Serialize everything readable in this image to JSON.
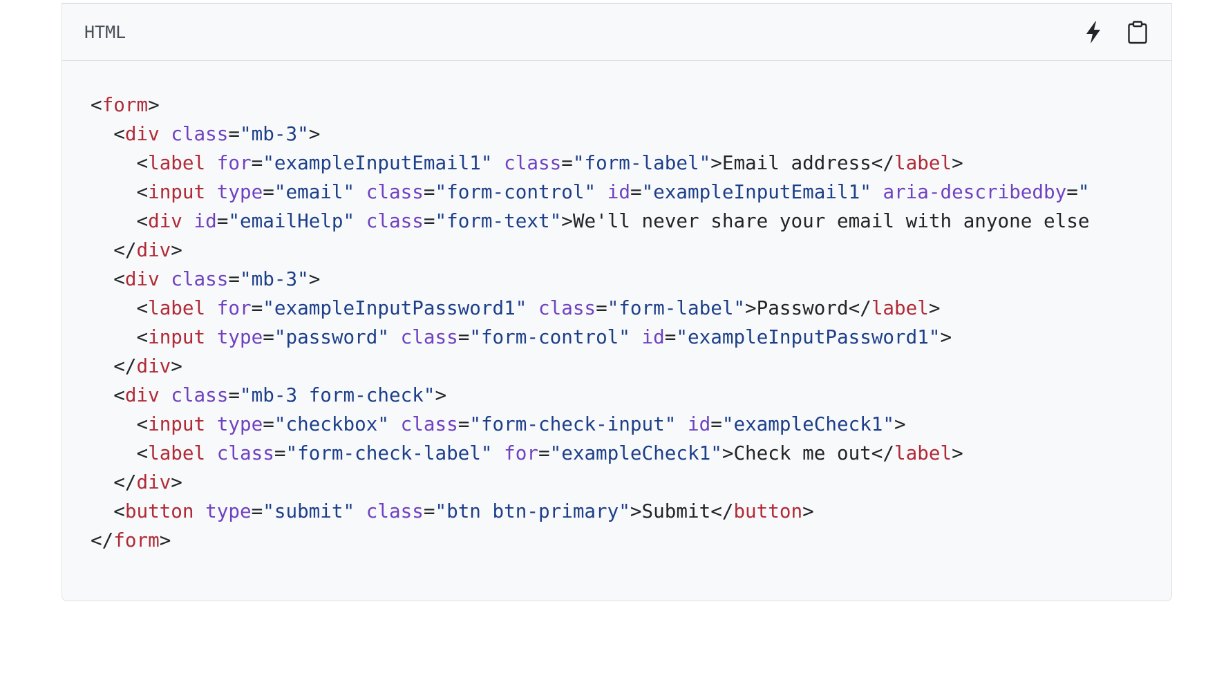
{
  "code_block": {
    "language_label": "HTML",
    "actions": [
      {
        "name": "lightning-icon"
      },
      {
        "name": "clipboard-icon"
      }
    ],
    "lines": [
      [
        {
          "t": "punc",
          "v": "<"
        },
        {
          "t": "tag",
          "v": "form"
        },
        {
          "t": "punc",
          "v": ">"
        }
      ],
      [
        {
          "t": "punc",
          "v": "  <"
        },
        {
          "t": "tag",
          "v": "div"
        },
        {
          "t": "punc",
          "v": " "
        },
        {
          "t": "attr",
          "v": "class"
        },
        {
          "t": "punc",
          "v": "="
        },
        {
          "t": "str",
          "v": "\"mb-3\""
        },
        {
          "t": "punc",
          "v": ">"
        }
      ],
      [
        {
          "t": "punc",
          "v": "    <"
        },
        {
          "t": "tag",
          "v": "label"
        },
        {
          "t": "punc",
          "v": " "
        },
        {
          "t": "attr",
          "v": "for"
        },
        {
          "t": "punc",
          "v": "="
        },
        {
          "t": "str",
          "v": "\"exampleInputEmail1\""
        },
        {
          "t": "punc",
          "v": " "
        },
        {
          "t": "attr",
          "v": "class"
        },
        {
          "t": "punc",
          "v": "="
        },
        {
          "t": "str",
          "v": "\"form-label\""
        },
        {
          "t": "punc",
          "v": ">"
        },
        {
          "t": "text",
          "v": "Email address"
        },
        {
          "t": "punc",
          "v": "</"
        },
        {
          "t": "tag",
          "v": "label"
        },
        {
          "t": "punc",
          "v": ">"
        }
      ],
      [
        {
          "t": "punc",
          "v": "    <"
        },
        {
          "t": "tag",
          "v": "input"
        },
        {
          "t": "punc",
          "v": " "
        },
        {
          "t": "attr",
          "v": "type"
        },
        {
          "t": "punc",
          "v": "="
        },
        {
          "t": "str",
          "v": "\"email\""
        },
        {
          "t": "punc",
          "v": " "
        },
        {
          "t": "attr",
          "v": "class"
        },
        {
          "t": "punc",
          "v": "="
        },
        {
          "t": "str",
          "v": "\"form-control\""
        },
        {
          "t": "punc",
          "v": " "
        },
        {
          "t": "attr",
          "v": "id"
        },
        {
          "t": "punc",
          "v": "="
        },
        {
          "t": "str",
          "v": "\"exampleInputEmail1\""
        },
        {
          "t": "punc",
          "v": " "
        },
        {
          "t": "attr",
          "v": "aria-describedby"
        },
        {
          "t": "punc",
          "v": "="
        },
        {
          "t": "str",
          "v": "\""
        }
      ],
      [
        {
          "t": "punc",
          "v": "    <"
        },
        {
          "t": "tag",
          "v": "div"
        },
        {
          "t": "punc",
          "v": " "
        },
        {
          "t": "attr",
          "v": "id"
        },
        {
          "t": "punc",
          "v": "="
        },
        {
          "t": "str",
          "v": "\"emailHelp\""
        },
        {
          "t": "punc",
          "v": " "
        },
        {
          "t": "attr",
          "v": "class"
        },
        {
          "t": "punc",
          "v": "="
        },
        {
          "t": "str",
          "v": "\"form-text\""
        },
        {
          "t": "punc",
          "v": ">"
        },
        {
          "t": "text",
          "v": "We'll never share your email with anyone else"
        }
      ],
      [
        {
          "t": "punc",
          "v": "  </"
        },
        {
          "t": "tag",
          "v": "div"
        },
        {
          "t": "punc",
          "v": ">"
        }
      ],
      [
        {
          "t": "punc",
          "v": "  <"
        },
        {
          "t": "tag",
          "v": "div"
        },
        {
          "t": "punc",
          "v": " "
        },
        {
          "t": "attr",
          "v": "class"
        },
        {
          "t": "punc",
          "v": "="
        },
        {
          "t": "str",
          "v": "\"mb-3\""
        },
        {
          "t": "punc",
          "v": ">"
        }
      ],
      [
        {
          "t": "punc",
          "v": "    <"
        },
        {
          "t": "tag",
          "v": "label"
        },
        {
          "t": "punc",
          "v": " "
        },
        {
          "t": "attr",
          "v": "for"
        },
        {
          "t": "punc",
          "v": "="
        },
        {
          "t": "str",
          "v": "\"exampleInputPassword1\""
        },
        {
          "t": "punc",
          "v": " "
        },
        {
          "t": "attr",
          "v": "class"
        },
        {
          "t": "punc",
          "v": "="
        },
        {
          "t": "str",
          "v": "\"form-label\""
        },
        {
          "t": "punc",
          "v": ">"
        },
        {
          "t": "text",
          "v": "Password"
        },
        {
          "t": "punc",
          "v": "</"
        },
        {
          "t": "tag",
          "v": "label"
        },
        {
          "t": "punc",
          "v": ">"
        }
      ],
      [
        {
          "t": "punc",
          "v": "    <"
        },
        {
          "t": "tag",
          "v": "input"
        },
        {
          "t": "punc",
          "v": " "
        },
        {
          "t": "attr",
          "v": "type"
        },
        {
          "t": "punc",
          "v": "="
        },
        {
          "t": "str",
          "v": "\"password\""
        },
        {
          "t": "punc",
          "v": " "
        },
        {
          "t": "attr",
          "v": "class"
        },
        {
          "t": "punc",
          "v": "="
        },
        {
          "t": "str",
          "v": "\"form-control\""
        },
        {
          "t": "punc",
          "v": " "
        },
        {
          "t": "attr",
          "v": "id"
        },
        {
          "t": "punc",
          "v": "="
        },
        {
          "t": "str",
          "v": "\"exampleInputPassword1\""
        },
        {
          "t": "punc",
          "v": ">"
        }
      ],
      [
        {
          "t": "punc",
          "v": "  </"
        },
        {
          "t": "tag",
          "v": "div"
        },
        {
          "t": "punc",
          "v": ">"
        }
      ],
      [
        {
          "t": "punc",
          "v": "  <"
        },
        {
          "t": "tag",
          "v": "div"
        },
        {
          "t": "punc",
          "v": " "
        },
        {
          "t": "attr",
          "v": "class"
        },
        {
          "t": "punc",
          "v": "="
        },
        {
          "t": "str",
          "v": "\"mb-3 form-check\""
        },
        {
          "t": "punc",
          "v": ">"
        }
      ],
      [
        {
          "t": "punc",
          "v": "    <"
        },
        {
          "t": "tag",
          "v": "input"
        },
        {
          "t": "punc",
          "v": " "
        },
        {
          "t": "attr",
          "v": "type"
        },
        {
          "t": "punc",
          "v": "="
        },
        {
          "t": "str",
          "v": "\"checkbox\""
        },
        {
          "t": "punc",
          "v": " "
        },
        {
          "t": "attr",
          "v": "class"
        },
        {
          "t": "punc",
          "v": "="
        },
        {
          "t": "str",
          "v": "\"form-check-input\""
        },
        {
          "t": "punc",
          "v": " "
        },
        {
          "t": "attr",
          "v": "id"
        },
        {
          "t": "punc",
          "v": "="
        },
        {
          "t": "str",
          "v": "\"exampleCheck1\""
        },
        {
          "t": "punc",
          "v": ">"
        }
      ],
      [
        {
          "t": "punc",
          "v": "    <"
        },
        {
          "t": "tag",
          "v": "label"
        },
        {
          "t": "punc",
          "v": " "
        },
        {
          "t": "attr",
          "v": "class"
        },
        {
          "t": "punc",
          "v": "="
        },
        {
          "t": "str",
          "v": "\"form-check-label\""
        },
        {
          "t": "punc",
          "v": " "
        },
        {
          "t": "attr",
          "v": "for"
        },
        {
          "t": "punc",
          "v": "="
        },
        {
          "t": "str",
          "v": "\"exampleCheck1\""
        },
        {
          "t": "punc",
          "v": ">"
        },
        {
          "t": "text",
          "v": "Check me out"
        },
        {
          "t": "punc",
          "v": "</"
        },
        {
          "t": "tag",
          "v": "label"
        },
        {
          "t": "punc",
          "v": ">"
        }
      ],
      [
        {
          "t": "punc",
          "v": "  </"
        },
        {
          "t": "tag",
          "v": "div"
        },
        {
          "t": "punc",
          "v": ">"
        }
      ],
      [
        {
          "t": "punc",
          "v": "  <"
        },
        {
          "t": "tag",
          "v": "button"
        },
        {
          "t": "punc",
          "v": " "
        },
        {
          "t": "attr",
          "v": "type"
        },
        {
          "t": "punc",
          "v": "="
        },
        {
          "t": "str",
          "v": "\"submit\""
        },
        {
          "t": "punc",
          "v": " "
        },
        {
          "t": "attr",
          "v": "class"
        },
        {
          "t": "punc",
          "v": "="
        },
        {
          "t": "str",
          "v": "\"btn btn-primary\""
        },
        {
          "t": "punc",
          "v": ">"
        },
        {
          "t": "text",
          "v": "Submit"
        },
        {
          "t": "punc",
          "v": "</"
        },
        {
          "t": "tag",
          "v": "button"
        },
        {
          "t": "punc",
          "v": ">"
        }
      ],
      [
        {
          "t": "punc",
          "v": "</"
        },
        {
          "t": "tag",
          "v": "form"
        },
        {
          "t": "punc",
          "v": ">"
        }
      ]
    ]
  },
  "colors": {
    "tag": "#b02a37",
    "attr": "#6f42c1",
    "string": "#1d3f8a",
    "text": "#212529",
    "background": "#f8f9fa",
    "border": "#dee2e6"
  }
}
